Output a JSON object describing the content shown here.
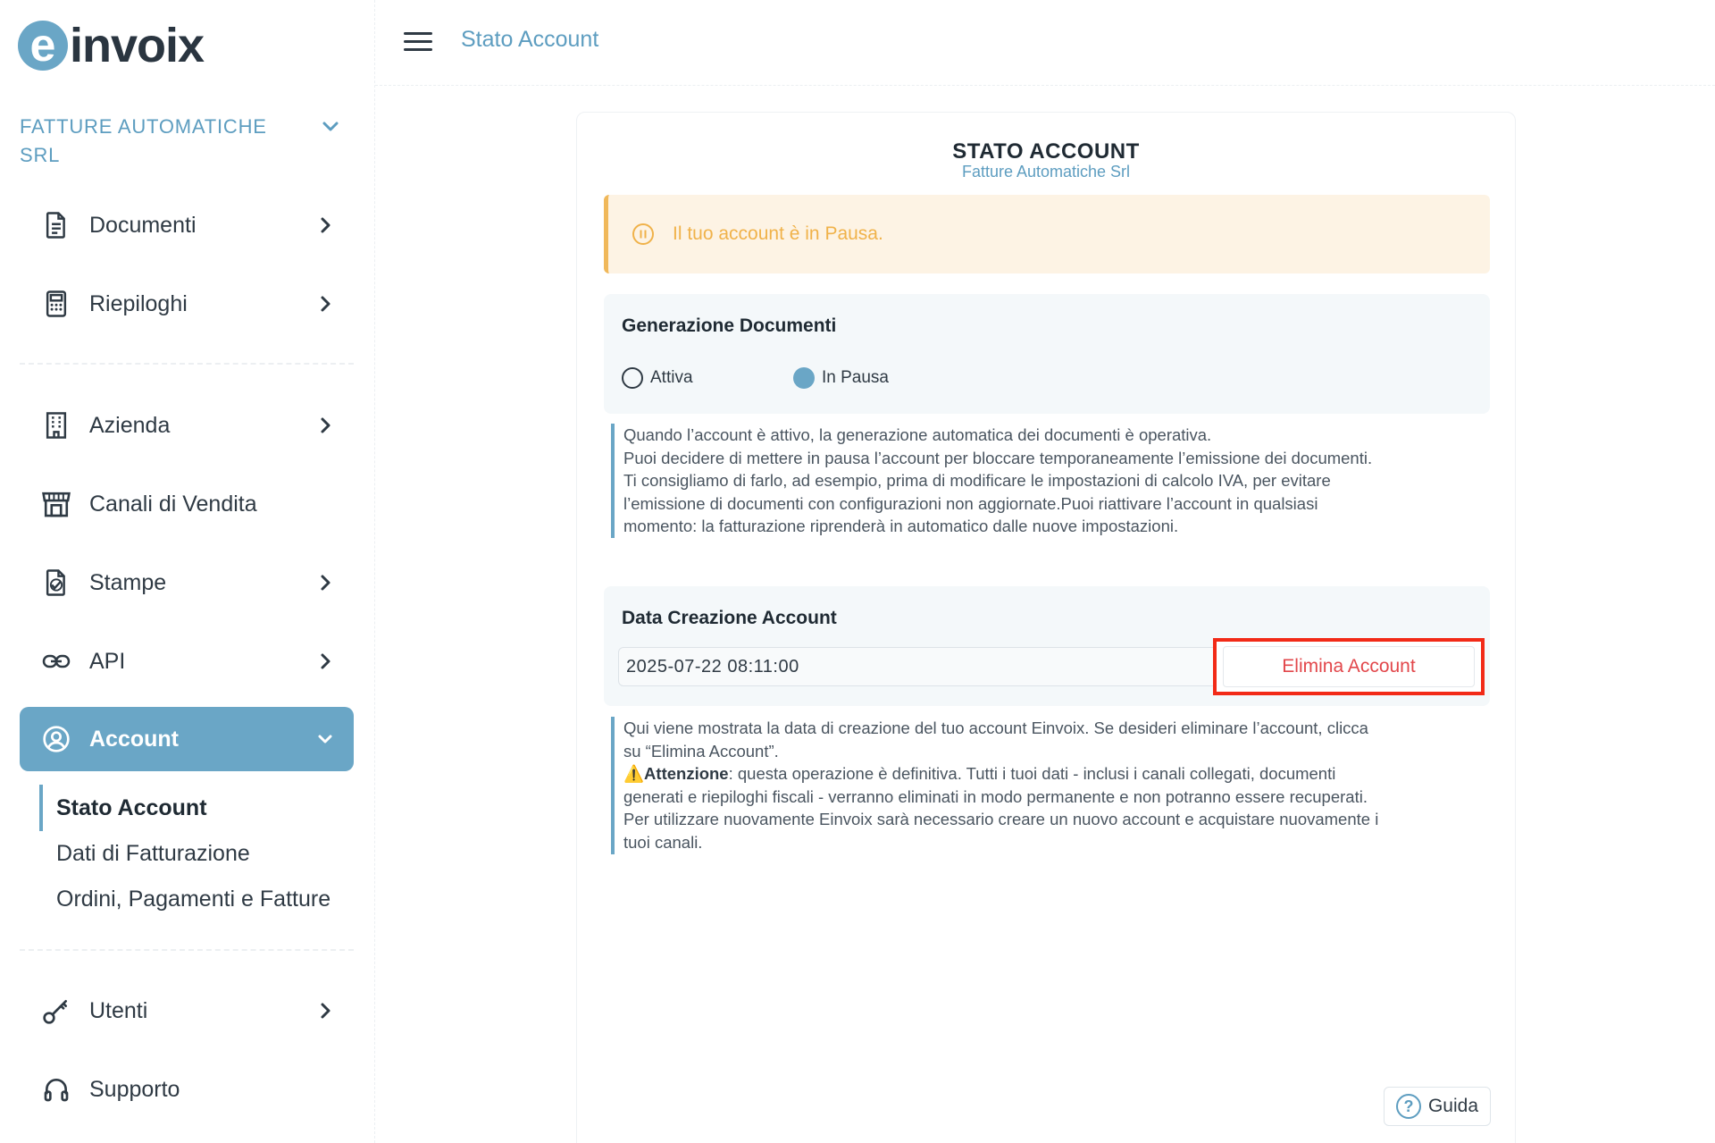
{
  "app": {
    "logo_mark": "e",
    "logo_text": "invoix"
  },
  "sidebar": {
    "company": "FATTURE AUTOMATICHE SRL",
    "items": [
      {
        "label": "Documenti",
        "icon": "document-icon"
      },
      {
        "label": "Riepiloghi",
        "icon": "calculator-icon"
      },
      {
        "label": "Azienda",
        "icon": "building-icon"
      },
      {
        "label": "Canali di Vendita",
        "icon": "store-icon"
      },
      {
        "label": "Stampe",
        "icon": "print-file-icon"
      },
      {
        "label": "API",
        "icon": "link-icon"
      },
      {
        "label": "Account",
        "icon": "user-circle-icon"
      },
      {
        "label": "Utenti",
        "icon": "key-icon"
      },
      {
        "label": "Supporto",
        "icon": "headset-icon"
      }
    ],
    "account_sub": [
      "Stato Account",
      "Dati di Fatturazione",
      "Ordini, Pagamenti e Fatture"
    ]
  },
  "topbar": {
    "breadcrumb": "Stato Account"
  },
  "card": {
    "title": "STATO ACCOUNT",
    "subtitle": "Fatture Automatiche Srl",
    "alert": "Il tuo account è in Pausa.",
    "generation": {
      "title": "Generazione Documenti",
      "options": [
        {
          "label": "Attiva",
          "checked": false
        },
        {
          "label": "In Pausa",
          "checked": true
        }
      ],
      "note": [
        "Quando l’account è attivo, la generazione automatica dei documenti è operativa.",
        "Puoi decidere di mettere in pausa l’account per bloccare temporaneamente l’emissione dei documenti.",
        "Ti consigliamo di farlo, ad esempio, prima di modificare le impostazioni di calcolo IVA, per evitare",
        "l’emissione di documenti con configurazioni non aggiornate.Puoi riattivare l’account in qualsiasi",
        "momento: la fatturazione riprenderà in automatico dalle nuove impostazioni."
      ]
    },
    "creation": {
      "title": "Data Creazione Account",
      "date_value": "2025-07-22 08:11:00",
      "delete_label": "Elimina Account",
      "note_line1": "Qui viene mostrata la data di creazione del tuo account Einvoix. Se desideri eliminare l’account, clicca",
      "note_line2": "su “Elimina Account”.",
      "warning_icon": "⚠️",
      "warning_title": "Attenzione",
      "note_line3": ": questa operazione è definitiva. Tutti i tuoi dati - inclusi i canali collegati, documenti",
      "note_line4": "generati e riepiloghi fiscali - verranno eliminati in modo permanente e non potranno essere recuperati.",
      "note_line5": "Per utilizzare nuovamente Einvoix sarà necessario creare un nuovo account e acquistare nuovamente i",
      "note_line6": "tuoi canali."
    },
    "guide_label": "Guida"
  },
  "colors": {
    "accent": "#6aa6c6",
    "link": "#5d9dc0",
    "warning": "#f0b24a",
    "danger": "#e2474b",
    "highlight": "#f22a17"
  }
}
